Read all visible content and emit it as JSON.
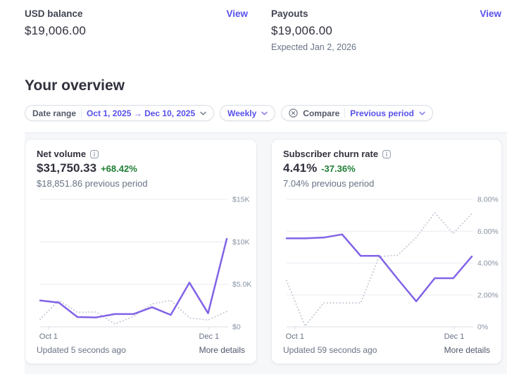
{
  "colors": {
    "accent_purple": "#5851ea",
    "chart_purple": "#8263e6",
    "chart_comparison_gray": "#c4c9d4",
    "positive_green": "#1e7e34",
    "text_primary": "#30313d",
    "text_secondary": "#687385",
    "panel_background": "#f6f7f9"
  },
  "icons": {
    "info": "rounded-square-i",
    "compare_remove": "circle-x",
    "chevron": "chevron-down",
    "range_arrow": "right-arrow"
  },
  "balances": {
    "usd": {
      "label": "USD balance",
      "value": "$19,006.00",
      "action": "View"
    },
    "payouts": {
      "label": "Payouts",
      "value": "$19,006.00",
      "note": "Expected Jan 2, 2026",
      "action": "View"
    }
  },
  "overview": {
    "title": "Your overview",
    "filters": {
      "date_range": {
        "label": "Date range",
        "value": "Oct 1, 2025 → Dec 10, 2025"
      },
      "interval": {
        "value": "Weekly"
      },
      "compare": {
        "label": "Compare",
        "value": "Previous period"
      }
    }
  },
  "chart_data": [
    {
      "type": "line",
      "title": "Net volume",
      "metric": {
        "value": "$31,750.33",
        "delta": "+68.42%",
        "previous": "$18,851.86 previous period"
      },
      "y_unit": "USD (thousands)",
      "ymax": 15,
      "y_ticks": [
        {
          "value": 0,
          "label": "$0"
        },
        {
          "value": 5,
          "label": "$5.0K"
        },
        {
          "value": 10,
          "label": "$10K"
        },
        {
          "value": 15,
          "label": "$15K"
        }
      ],
      "x_ticks": [
        {
          "frac": 0.045,
          "label": "Oct 1"
        },
        {
          "frac": 0.905,
          "label": "Dec 1"
        }
      ],
      "series": [
        {
          "name": "previous period",
          "style": "dotted",
          "color": "#c4c9d4",
          "values": [
            0.9,
            3.1,
            1.7,
            1.75,
            0.35,
            1.2,
            2.7,
            3.1,
            1.05,
            0.8,
            1.8
          ]
        },
        {
          "name": "current period",
          "style": "solid",
          "color": "#8263e6",
          "values": [
            3.1,
            2.85,
            1.15,
            1.1,
            1.5,
            1.5,
            2.3,
            1.4,
            5.2,
            1.6,
            10.35
          ]
        }
      ],
      "updated": "Updated 5 seconds ago",
      "more_details": "More details"
    },
    {
      "type": "line",
      "title": "Subscriber churn rate",
      "metric": {
        "value": "4.41%",
        "delta": "-37.36%",
        "previous": "7.04% previous period"
      },
      "y_unit": "percent",
      "ymax": 8,
      "y_ticks": [
        {
          "value": 0,
          "label": "0%"
        },
        {
          "value": 2,
          "label": "2.00%"
        },
        {
          "value": 4,
          "label": "4.00%"
        },
        {
          "value": 6,
          "label": "6.00%"
        },
        {
          "value": 8,
          "label": "8.00%"
        }
      ],
      "x_ticks": [
        {
          "frac": 0.045,
          "label": "Oct 1"
        },
        {
          "frac": 0.905,
          "label": "Dec 1"
        }
      ],
      "series": [
        {
          "name": "previous period",
          "style": "dotted",
          "color": "#c4c9d4",
          "values": [
            2.9,
            0.05,
            1.5,
            1.5,
            1.5,
            4.4,
            4.5,
            5.6,
            7.15,
            5.85,
            7.1
          ]
        },
        {
          "name": "current period",
          "style": "solid",
          "color": "#8263e6",
          "values": [
            5.55,
            5.55,
            5.6,
            5.8,
            4.45,
            4.45,
            3.0,
            1.6,
            3.05,
            3.05,
            4.41
          ]
        }
      ],
      "updated": "Updated 59 seconds ago",
      "more_details": "More details"
    }
  ]
}
